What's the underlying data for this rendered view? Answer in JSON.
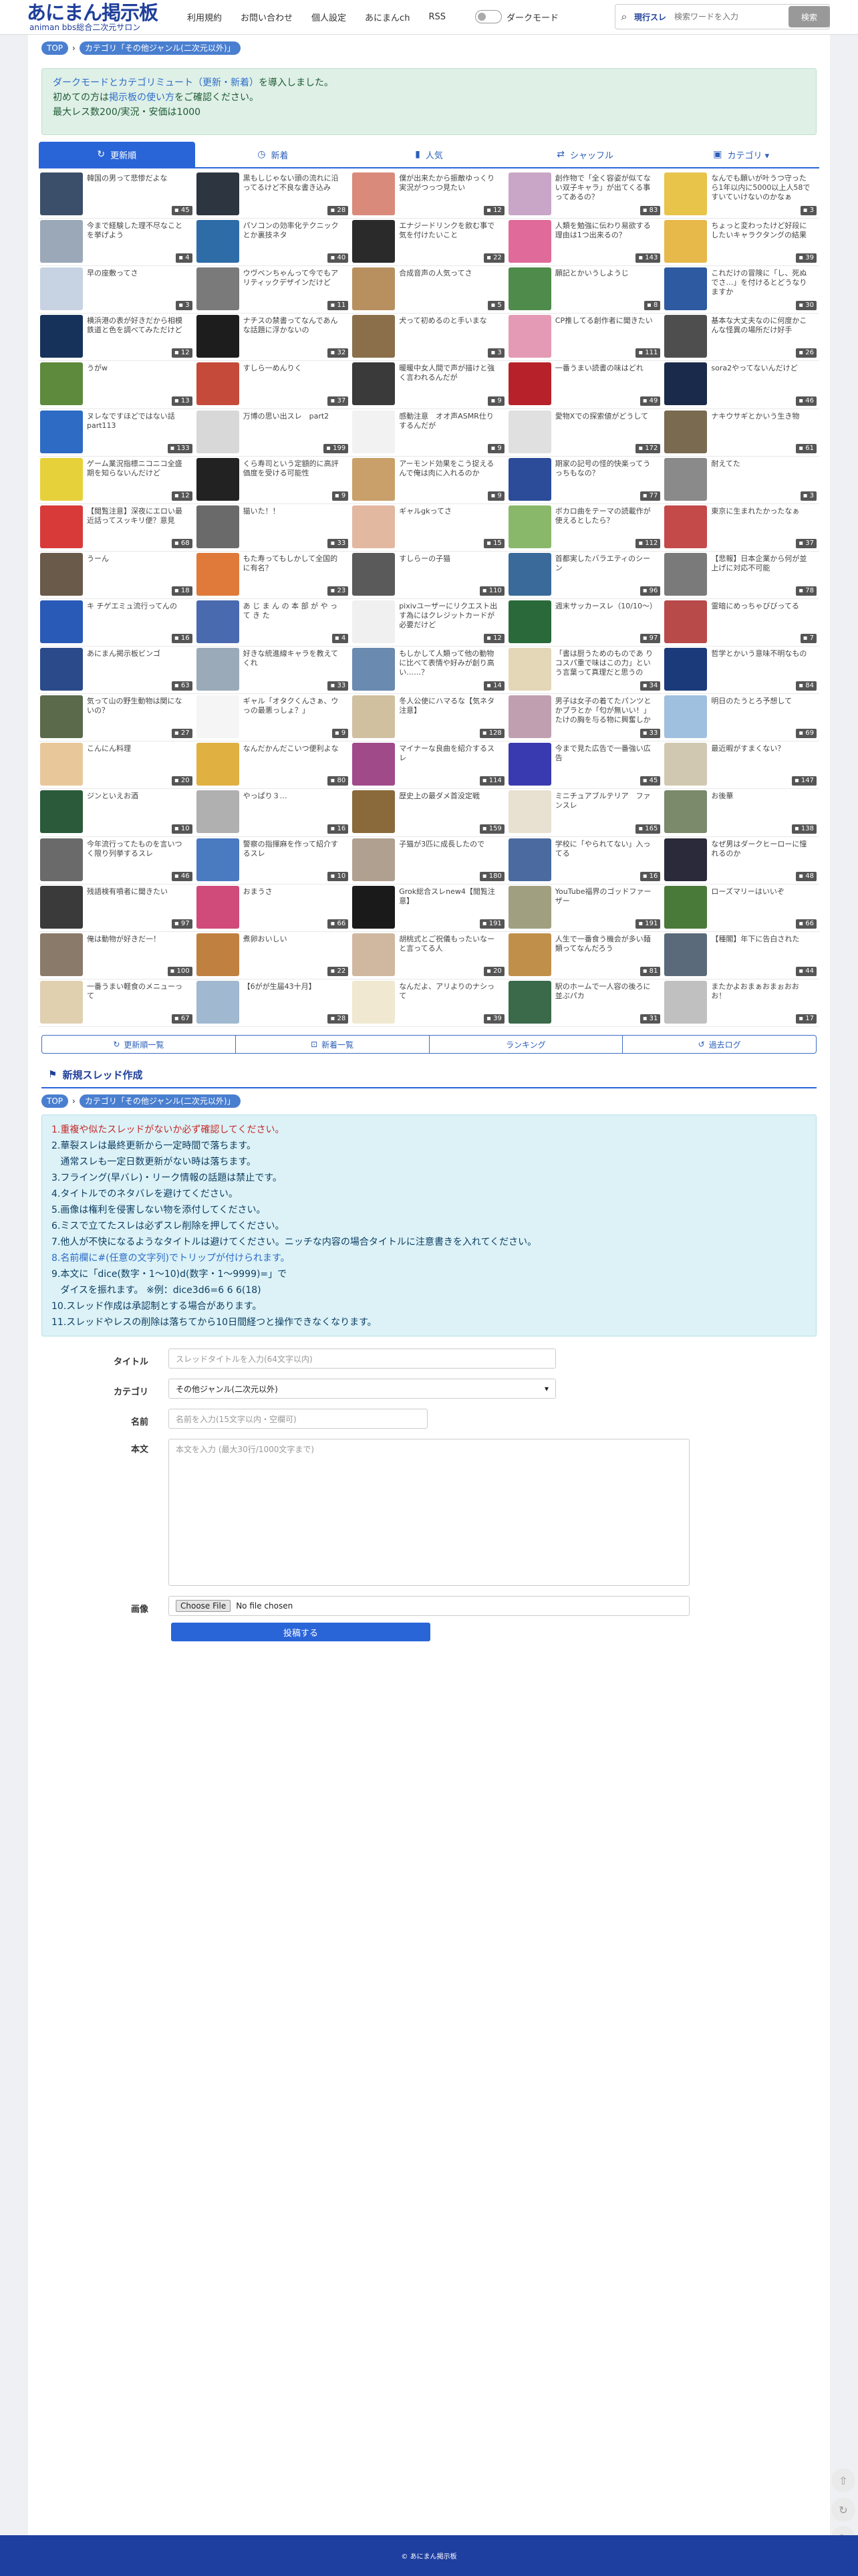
{
  "header": {
    "logo_main": "あにまん掲示板",
    "logo_sub": "animan bbs総合二次元サロン",
    "nav": [
      "利用規約",
      "お問い合わせ",
      "個人設定",
      "あにまんch",
      "RSS"
    ],
    "dark_mode_label": "ダークモード",
    "search_scope": "現行スレ",
    "search_placeholder": "検索ワードを入力",
    "search_button": "検索"
  },
  "breadcrumb": {
    "top": "TOP",
    "category": "カテゴリ「その他ジャンル(二次元以外)」"
  },
  "notice": {
    "line1_a": "ダークモードとカテゴリミュート（更新・新着）",
    "line1_b": "を導入しました。",
    "line2_a": "初めての方は",
    "line2_b": "掲示板の使い方",
    "line2_c": "をご確認ください。",
    "line3": "最大レス数200/実況・安価は1000"
  },
  "tabs": [
    {
      "label": "更新順",
      "icon": "↻",
      "active": true
    },
    {
      "label": "新着",
      "icon": "◷",
      "active": false
    },
    {
      "label": "人気",
      "icon": "▮",
      "active": false
    },
    {
      "label": "シャッフル",
      "icon": "⇄",
      "active": false
    },
    {
      "label": "カテゴリ ▾",
      "icon": "▣",
      "active": false
    }
  ],
  "threads": [
    {
      "title": "韓国の男って悲惨だよな",
      "count": "45",
      "color": "#3b4f6a"
    },
    {
      "title": "黒もしじゃない頭の流れに沿ってるけど不良な書き込み",
      "count": "28",
      "color": "#2d3540"
    },
    {
      "title": "僕が出来たから振敵ゆっくり実況がつっつ見たい",
      "count": "12",
      "color": "#d98a7a"
    },
    {
      "title": "創作物で「全く容姿が似てない双子キャラ」が出てくる事ってあるの？",
      "count": "83",
      "color": "#c9a6c8"
    },
    {
      "title": "なんでも願いが叶うつ守ったら1年以内に5000以上人58ですいていけないのかなぁ",
      "count": "3",
      "color": "#e8c44a"
    },
    {
      "title": "今まで経験した理不尽なことを挙げよう",
      "count": "4",
      "color": "#9aa8b8"
    },
    {
      "title": "パソコンの効率化テクニックとか裏技ネタ",
      "count": "40",
      "color": "#2e6ca8"
    },
    {
      "title": "エナジードリンクを飲む事で気を付けたいこと",
      "count": "22",
      "color": "#2a2a2a"
    },
    {
      "title": "人類を勉強に伝わり易欲する理由は1つ出来るの？",
      "count": "143",
      "color": "#e06a9a"
    },
    {
      "title": "ちょっと変わったけど好段にしたいキャラクタングの結果",
      "count": "39",
      "color": "#e7b84a"
    },
    {
      "title": "早の座敷ってさ",
      "count": "3",
      "color": "#c7d3e2"
    },
    {
      "title": "ウヴベンちゃんって今でもアリティックデザインだけど",
      "count": "11",
      "color": "#7a7a7a"
    },
    {
      "title": "合成音声の人気ってさ",
      "count": "5",
      "color": "#b89060"
    },
    {
      "title": "願記とかいうしようじ",
      "count": "8",
      "color": "#4f8b4a"
    },
    {
      "title": "これだけの冒険に「し、死ぬでさ…」を付けるとどうなりますか",
      "count": "30",
      "color": "#2d5aa0"
    },
    {
      "title": "横浜港の表が好きだから相模鉄道と色を調べてみただけど",
      "count": "12",
      "color": "#16325a"
    },
    {
      "title": "ナチスの禁書ってなんであんな話題に浮かないの",
      "count": "32",
      "color": "#1d1d1d"
    },
    {
      "title": "犬って初めるのと手いまな",
      "count": "3",
      "color": "#8a6f4a"
    },
    {
      "title": "CP推してる創作者に聞きたい",
      "count": "111",
      "color": "#e49ab5"
    },
    {
      "title": "基本な大丈夫なのに何度かこんな怪異の場所だけ好手",
      "count": "26",
      "color": "#4e4e4e"
    },
    {
      "title": "うがw",
      "count": "13",
      "color": "#5d8a3c"
    },
    {
      "title": "すしら一めんりく",
      "count": "37",
      "color": "#c54a3a"
    },
    {
      "title": "暖暖中女人間で声が描けと強く言われるんだが",
      "count": "9",
      "color": "#3a3a3a"
    },
    {
      "title": "一番うまい読書の味はどれ",
      "count": "49",
      "color": "#b7222a"
    },
    {
      "title": "sora2やってないんだけど",
      "count": "46",
      "color": "#1a2a4a"
    },
    {
      "title": "ヌレなですほどではない話part113",
      "count": "133",
      "color": "#2d6bc5"
    },
    {
      "title": "万博の思い出スレ　part2",
      "count": "199",
      "color": "#d8d8d8"
    },
    {
      "title": "感動注意　オオ声ASMR仕りするんだが",
      "count": "9",
      "color": "#f2f2f2"
    },
    {
      "title": "愛物Xでの探索値がどうして",
      "count": "172",
      "color": "#e0e0e0"
    },
    {
      "title": "ナキウサギとかいう生き物",
      "count": "61",
      "color": "#7a6a50"
    },
    {
      "title": "ゲーム業況指標ニコニコ全盛期を知らないんだけど",
      "count": "12",
      "color": "#e7d13a"
    },
    {
      "title": "くら寿司という定額的に高評価度を受ける可能性",
      "count": "9",
      "color": "#222222"
    },
    {
      "title": "アーモンド効果をこう捉えるんで俺は肉に入れるのか",
      "count": "9",
      "color": "#c9a06a"
    },
    {
      "title": "期家の記号の怪的快楽ってうっちもなの？",
      "count": "77",
      "color": "#2c4c9a"
    },
    {
      "title": "耐えてた",
      "count": "3",
      "color": "#8a8a8a"
    },
    {
      "title": "【閲覧注意】深夜にエロい最近話ってスッキリ便？意見",
      "count": "68",
      "color": "#d83a3a"
    },
    {
      "title": "猫いた！！",
      "count": "33",
      "color": "#6a6a6a"
    },
    {
      "title": "ギャルgkってさ",
      "count": "15",
      "color": "#e3b8a0"
    },
    {
      "title": "ボカロ曲をテーマの読載作が使えるとしたら？",
      "count": "112",
      "color": "#8ab86a"
    },
    {
      "title": "東京に生まれたかったなぁ",
      "count": "37",
      "color": "#c44a4a"
    },
    {
      "title": "うーん",
      "count": "18",
      "color": "#6a5a4a"
    },
    {
      "title": "もた寿ってもしかして全国的に有名？",
      "count": "23",
      "color": "#e07a3a"
    },
    {
      "title": "すしらーの子猫",
      "count": "110",
      "color": "#5a5a5a"
    },
    {
      "title": "首都実したバラエティのシーン",
      "count": "96",
      "color": "#3a6a9a"
    },
    {
      "title": "【悲報】日本企業から何が並上げに対応不可能",
      "count": "78",
      "color": "#7a7a7a"
    },
    {
      "title": "キ チゲエミュ流行ってんの",
      "count": "16",
      "color": "#2a5ab8"
    },
    {
      "title": "あ じ ま ん の 本 部 が や っ て き た",
      "count": "4",
      "color": "#4a6ab0"
    },
    {
      "title": "pixivユーザーにリクエスト出す為にはクレジットカードが必要だけど",
      "count": "12",
      "color": "#f0f0f0"
    },
    {
      "title": "週末サッカースレ（10/10〜）",
      "count": "97",
      "color": "#2a6a3a"
    },
    {
      "title": "霊暗にめっちゃびびってる",
      "count": "7",
      "color": "#b84a4a"
    },
    {
      "title": "あにまん掲示板ビンゴ",
      "count": "63",
      "color": "#2a4a8a"
    },
    {
      "title": "好きな統進線キャラを教えてくれ",
      "count": "33",
      "color": "#9aaab8"
    },
    {
      "title": "もしかして人類って他の動物に比べて表情や好みが創り高い……？",
      "count": "14",
      "color": "#6a8ab0"
    },
    {
      "title": "「書は厨うためのものであ りコスパ重で味はこの力」という言葉って真理だと思うの",
      "count": "34",
      "color": "#e3d7b8"
    },
    {
      "title": "哲学とかいう意味不明なもの",
      "count": "84",
      "color": "#1a3a7a"
    },
    {
      "title": "気って山の野生動物は関にないの？",
      "count": "27",
      "color": "#5a6a4a"
    },
    {
      "title": "ギャル「オタクくんさぁ、ウっの最悪っしょ？」",
      "count": "9",
      "color": "#f5f5f5"
    },
    {
      "title": "冬人公使にハマるな【気ネタ注意】",
      "count": "128",
      "color": "#d0c0a0"
    },
    {
      "title": "男子は女子の着てたパンツとかブラとか「匂が無いい！」たけの胸を与る物に興奮しかちだけど",
      "count": "33",
      "color": "#c0a0b0"
    },
    {
      "title": "明日のたうとろ予想して",
      "count": "69",
      "color": "#a0c0e0"
    },
    {
      "title": "こんにん料理",
      "count": "20",
      "color": "#e8c89a"
    },
    {
      "title": "なんだかんだこいつ便利よな",
      "count": "80",
      "color": "#e0b040"
    },
    {
      "title": "マイナーな良曲を紹介するスレ",
      "count": "114",
      "color": "#a04a8a"
    },
    {
      "title": "今まで見た広告で一番強い広告",
      "count": "45",
      "color": "#3a3ab0"
    },
    {
      "title": "最近暇がすまくない？",
      "count": "147",
      "color": "#d0c8b0"
    },
    {
      "title": "ジンといえお酒",
      "count": "10",
      "color": "#2a5a3a"
    },
    {
      "title": "やっぱり３…",
      "count": "16",
      "color": "#b0b0b0"
    },
    {
      "title": "歴史上の最ダメ首没定戦",
      "count": "159",
      "color": "#8a6a3a"
    },
    {
      "title": "ミニチュアブルテリア　ファンスレ",
      "count": "165",
      "color": "#e8e0d0"
    },
    {
      "title": "お後華",
      "count": "138",
      "color": "#7a8a6a"
    },
    {
      "title": "今年流行ってたものを言いつく限り列挙するスレ",
      "count": "46",
      "color": "#6a6a6a"
    },
    {
      "title": "警察の指揮麻を作って紹介するスレ",
      "count": "10",
      "color": "#4a7ac0"
    },
    {
      "title": "子猫が3匹に成長したので",
      "count": "180",
      "color": "#b0a090"
    },
    {
      "title": "学校に「やられてない」入ってる",
      "count": "16",
      "color": "#4a6aa0"
    },
    {
      "title": "なぜ男はダークヒーローに憧れるのか",
      "count": "48",
      "color": "#2a2a3a"
    },
    {
      "title": "残語検有噴者に聞きたい",
      "count": "97",
      "color": "#3a3a3a"
    },
    {
      "title": "おまうさ",
      "count": "66",
      "color": "#d04a7a"
    },
    {
      "title": "Grok総合スレnew4【閲覧注意】",
      "count": "191",
      "color": "#1a1a1a"
    },
    {
      "title": "YouTube福界のゴッドファーザー",
      "count": "191",
      "color": "#a0a080"
    },
    {
      "title": "ローズマリーはいいぞ",
      "count": "66",
      "color": "#4a7a3a"
    },
    {
      "title": "俺は動物が好きだ一！",
      "count": "100",
      "color": "#8a7a6a"
    },
    {
      "title": "煮卵おいしい",
      "count": "22",
      "color": "#c08040"
    },
    {
      "title": "胡桃式とご祝儀もったいなーと言ってる人",
      "count": "20",
      "color": "#d0b8a0"
    },
    {
      "title": "人生で一番食う機会が多い麺類ってなんだろう",
      "count": "81",
      "color": "#c0904a"
    },
    {
      "title": "【種閣】年下に告白された",
      "count": "44",
      "color": "#5a6a7a"
    },
    {
      "title": "一番うまい軽食のメニューって",
      "count": "67",
      "color": "#e0d0b0"
    },
    {
      "title": "【6がが生届43十月】",
      "count": "28",
      "color": "#a0b8d0"
    },
    {
      "title": "なんだよ、アリよりのナシって",
      "count": "39",
      "color": "#f0e8d0"
    },
    {
      "title": "駅のホームで一人容の後ろに並ぶパカ",
      "count": "31",
      "color": "#3a6a4a"
    },
    {
      "title": "またかよおまぁおまぉおおお！",
      "count": "17",
      "color": "#c0c0c0"
    }
  ],
  "bottom_nav": [
    "更新順一覧",
    "新着一覧",
    "ランキング",
    "過去ログ"
  ],
  "new_thread": {
    "heading": "新規スレッド作成",
    "rules": [
      "1.重複や似たスレッドがないか必ず確認してください。",
      "2.華裂スレは最終更新から一定時間で落ちます。",
      "   通常スレも一定日数更新がない時は落ちます。",
      "3.フライング(早バレ)・リーク情報の話題は禁止です。",
      "4.タイトルでのネタバレを避けてください。",
      "5.画像は権利を侵害しない物を添付してください。",
      "6.ミスで立てたスレは必ずスレ削除を押してください。",
      "7.他人が不快になるようなタイトルは避けてください。ニッチな内容の場合タイトルに注意書きを入れてください。",
      "8.名前欄に#(任意の文字列)でトリップが付けられます。",
      "9.本文に「dice(数字・1〜10)d(数字・1〜9999)=」で",
      "   ダイスを振れます。 ※例：dice3d6=6 6 6(18)",
      "10.スレッド作成は承認制とする場合があります。",
      "11.スレッドやレスの削除は落ちてから10日間経つと操作できなくなります。"
    ],
    "labels": {
      "title": "タイトル",
      "category": "カテゴリ",
      "name": "名前",
      "body": "本文",
      "image": "画像"
    },
    "placeholders": {
      "title": "スレッドタイトルを入力(64文字以内)",
      "name": "名前を入力(15文字以内・空欄可)",
      "body": "本文を入力 (最大30行/1000文字まで)"
    },
    "category_value": "その他ジャンル(二次元以外)",
    "file_button": "Choose File",
    "file_status": "No file chosen",
    "submit": "投稿する"
  },
  "footer": "© あにまん掲示板"
}
